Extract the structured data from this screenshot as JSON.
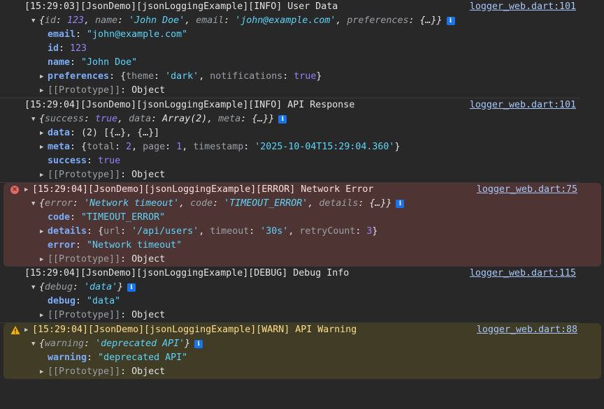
{
  "entries": [
    {
      "header": "[15:29:03][JsonDemo][jsonLoggingExample][INFO] User Data",
      "source": "logger_web.dart:101",
      "summary": {
        "prefix": "{",
        "parts": [
          [
            "id",
            "123",
            "n"
          ],
          [
            "name",
            "'John Doe'",
            "s"
          ],
          [
            "email",
            "'john@example.com'",
            "s"
          ],
          [
            "preferences",
            "{…}",
            "plain"
          ]
        ],
        "suffix": "}"
      },
      "props": [
        {
          "key": "email",
          "value": "\"john@example.com\"",
          "type": "s",
          "expandable": false
        },
        {
          "key": "id",
          "value": "123",
          "type": "n",
          "expandable": false
        },
        {
          "key": "name",
          "value": "\"John Doe\"",
          "type": "s",
          "expandable": false
        },
        {
          "key": "preferences",
          "expandable": true,
          "preview": [
            [
              "theme",
              "'dark'",
              "s"
            ],
            [
              "notifications",
              "true",
              "b"
            ]
          ]
        }
      ],
      "prototype": "[[Prototype]]: Object"
    },
    {
      "header": "[15:29:04][JsonDemo][jsonLoggingExample][INFO] API Response",
      "source": "logger_web.dart:101",
      "summary": {
        "prefix": "{",
        "parts": [
          [
            "success",
            "true",
            "b"
          ],
          [
            "data",
            "Array(2)",
            "plain"
          ],
          [
            "meta",
            "{…}",
            "plain"
          ]
        ],
        "suffix": "}"
      },
      "props": [
        {
          "key": "data",
          "expandable": true,
          "raw": "(2) [{…}, {…}]"
        },
        {
          "key": "meta",
          "expandable": true,
          "preview": [
            [
              "total",
              "2",
              "n"
            ],
            [
              "page",
              "1",
              "n"
            ],
            [
              "timestamp",
              "'2025-10-04T15:29:04.360'",
              "s"
            ]
          ]
        },
        {
          "key": "success",
          "value": "true",
          "type": "b",
          "expandable": false
        }
      ],
      "prototype": "[[Prototype]]: Object"
    },
    {
      "level": "error",
      "header": "[15:29:04][JsonDemo][jsonLoggingExample][ERROR] Network Error",
      "source": "logger_web.dart:75",
      "summary": {
        "prefix": "{",
        "parts": [
          [
            "error",
            "'Network timeout'",
            "s"
          ],
          [
            "code",
            "'TIMEOUT_ERROR'",
            "s"
          ],
          [
            "details",
            "{…}",
            "plain"
          ]
        ],
        "suffix": "}"
      },
      "props": [
        {
          "key": "code",
          "value": "\"TIMEOUT_ERROR\"",
          "type": "s",
          "expandable": false
        },
        {
          "key": "details",
          "expandable": true,
          "preview": [
            [
              "url",
              "'/api/users'",
              "s"
            ],
            [
              "timeout",
              "'30s'",
              "s"
            ],
            [
              "retryCount",
              "3",
              "n"
            ]
          ]
        },
        {
          "key": "error",
          "value": "\"Network timeout\"",
          "type": "s",
          "expandable": false
        }
      ],
      "prototype": "[[Prototype]]: Object"
    },
    {
      "header": "[15:29:04][JsonDemo][jsonLoggingExample][DEBUG] Debug Info",
      "source": "logger_web.dart:115",
      "summary": {
        "prefix": "{",
        "parts": [
          [
            "debug",
            "'data'",
            "s"
          ]
        ],
        "suffix": "}"
      },
      "props": [
        {
          "key": "debug",
          "value": "\"data\"",
          "type": "s",
          "expandable": false
        }
      ],
      "prototype": "[[Prototype]]: Object"
    },
    {
      "level": "warn",
      "header": "[15:29:04][JsonDemo][jsonLoggingExample][WARN] API Warning",
      "source": "logger_web.dart:88",
      "summary": {
        "prefix": "{",
        "parts": [
          [
            "warning",
            "'deprecated API'",
            "s"
          ]
        ],
        "suffix": "}"
      },
      "props": [
        {
          "key": "warning",
          "value": "\"deprecated API\"",
          "type": "s",
          "expandable": false
        }
      ],
      "prototype": "[[Prototype]]: Object"
    }
  ],
  "icons": {
    "info": "info-icon",
    "error": "error-icon",
    "warn": "warning-icon",
    "expanded": "triangle-down-icon",
    "collapsed": "triangle-right-icon"
  },
  "colors": {
    "background": "#282828",
    "error_bg": "#4e3534",
    "warn_bg": "#413c26",
    "link": "#a8c7fa",
    "string": "#5cd5fb",
    "number": "#9980ff",
    "key": "#7cacf8"
  }
}
